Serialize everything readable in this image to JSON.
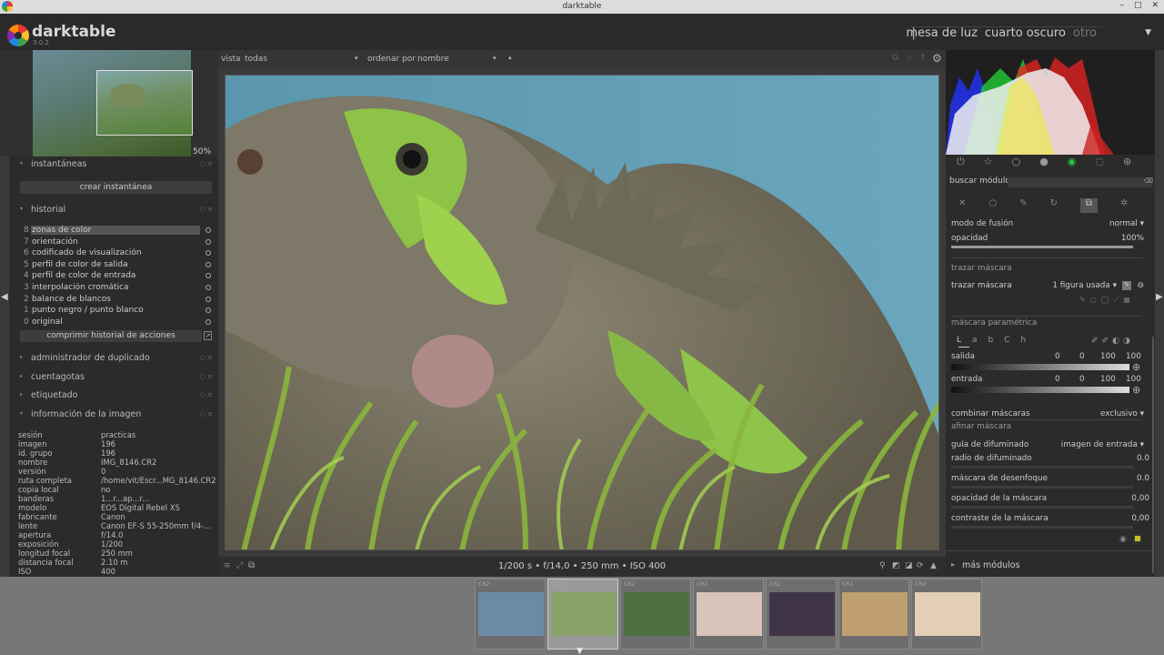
{
  "window": {
    "title": "darktable"
  },
  "app": {
    "name": "darktable",
    "version": "3.0.2"
  },
  "views": {
    "items": [
      "mesa de luz",
      "cuarto oscuro",
      "otro"
    ],
    "separator": "|"
  },
  "navigation": {
    "zoom": "50%"
  },
  "left": {
    "snapshots": {
      "title": "instantáneas",
      "button": "crear instantánea"
    },
    "history": {
      "title": "historial",
      "items": [
        {
          "n": "8",
          "label": "zonas de color"
        },
        {
          "n": "7",
          "label": "orientación"
        },
        {
          "n": "6",
          "label": "codificado de visualización"
        },
        {
          "n": "5",
          "label": "perfil de color de salida"
        },
        {
          "n": "4",
          "label": "perfil de color de entrada"
        },
        {
          "n": "3",
          "label": "interpolación cromática"
        },
        {
          "n": "2",
          "label": "balance de blancos"
        },
        {
          "n": "1",
          "label": "punto negro / punto blanco"
        },
        {
          "n": "0",
          "label": "original"
        }
      ],
      "compress": "comprimir historial de acciones"
    },
    "duplicates": "administrador de duplicado",
    "colorpicker": "cuentagotas",
    "tagging": "etiquetado",
    "imageinfo": {
      "title": "información de la imagen",
      "rows": [
        {
          "k": "sesión",
          "v": "practicas"
        },
        {
          "k": "imagen",
          "v": "196"
        },
        {
          "k": "id. grupo",
          "v": "196"
        },
        {
          "k": "nombre",
          "v": "IMG_8146.CR2"
        },
        {
          "k": "versión",
          "v": "0"
        },
        {
          "k": "ruta completa",
          "v": "/home/vit/Escr...MG_8146.CR2"
        },
        {
          "k": "copia local",
          "v": "no"
        },
        {
          "k": "banderas",
          "v": "1...r...ap...r..."
        },
        {
          "k": "modelo",
          "v": "EOS Digital Rebel XS"
        },
        {
          "k": "fabricante",
          "v": "Canon"
        },
        {
          "k": "lente",
          "v": "Canon EF-S 55-250mm f/4-..."
        },
        {
          "k": "apertura",
          "v": "f/14.0"
        },
        {
          "k": "exposición",
          "v": "1/200"
        },
        {
          "k": "longitud focal",
          "v": "250 mm"
        },
        {
          "k": "distancia focal",
          "v": "2.10 m"
        },
        {
          "k": "ISO",
          "v": "400"
        }
      ]
    }
  },
  "center": {
    "filter": {
      "vista_label": "vista",
      "vista_value": "todas",
      "sort_label": "ordenar por",
      "sort_value": "nombre"
    },
    "exif_line": "1/200 s • f/14,0 • 250 mm • ISO 400"
  },
  "right": {
    "search_label": "buscar módulo",
    "blend": {
      "mode_label": "modo de fusión",
      "mode_value": "normal",
      "opacity_label": "opacidad",
      "opacity_value": "100%",
      "opacity_fraction": 1.0
    },
    "drawn": {
      "section": "trazar máscara",
      "label": "trazar máscara",
      "value": "1 figura usada"
    },
    "parametric": {
      "section": "máscara paramétrica",
      "channels": [
        "L",
        "a",
        "b",
        "C",
        "h"
      ],
      "output": {
        "label": "salida",
        "values": [
          "0",
          "0",
          "100",
          "100"
        ]
      },
      "input": {
        "label": "entrada",
        "values": [
          "0",
          "0",
          "100",
          "100"
        ]
      }
    },
    "combine": {
      "label": "combinar máscaras",
      "value": "exclusivo"
    },
    "refine": {
      "section": "afinar máscara",
      "guide": {
        "label": "guía de difuminado",
        "value": "imagen de entrada"
      },
      "rows": [
        {
          "label": "radio de difuminado",
          "value": "0.0"
        },
        {
          "label": "máscara de desenfoque",
          "value": "0.0"
        },
        {
          "label": "opacidad de la máscara",
          "value": "0,00"
        },
        {
          "label": "contraste de la máscara",
          "value": "0,00"
        }
      ]
    },
    "more_modules": "más módulos"
  },
  "filmstrip": {
    "label": "CR2",
    "count": 7,
    "selected_index": 1,
    "colors": [
      "#6b8aa5",
      "#8aa36a",
      "#4c7040",
      "#d8c4b8",
      "#403548",
      "#c0a070",
      "#e2cfb6"
    ]
  }
}
